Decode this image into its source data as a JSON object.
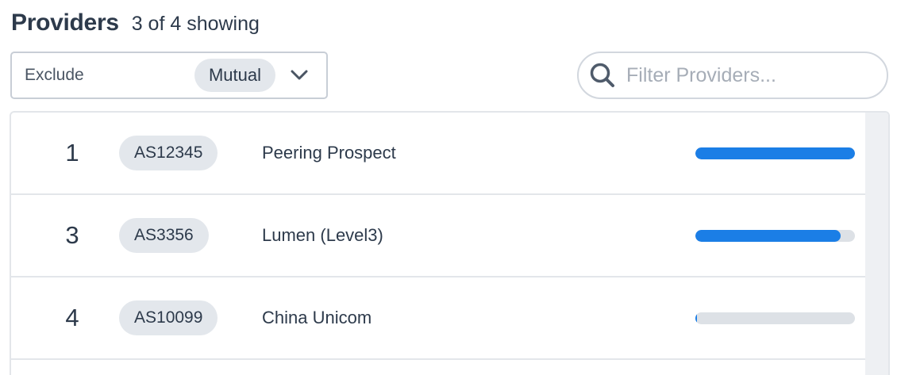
{
  "header": {
    "title": "Providers",
    "count_text": "3 of 4 showing"
  },
  "filter": {
    "label": "Exclude",
    "selected": "Mutual"
  },
  "search": {
    "placeholder": "Filter Providers..."
  },
  "colors": {
    "accent": "#1b7ee6",
    "chip_bg": "#e3e7ec",
    "track_bg": "#dde1e6"
  },
  "providers": [
    {
      "rank": "1",
      "asn": "AS12345",
      "name": "Peering Prospect",
      "share": 1.0
    },
    {
      "rank": "3",
      "asn": "AS3356",
      "name": "Lumen (Level3)",
      "share": 0.91
    },
    {
      "rank": "4",
      "asn": "AS10099",
      "name": "China Unicom",
      "share": 0.01
    }
  ]
}
